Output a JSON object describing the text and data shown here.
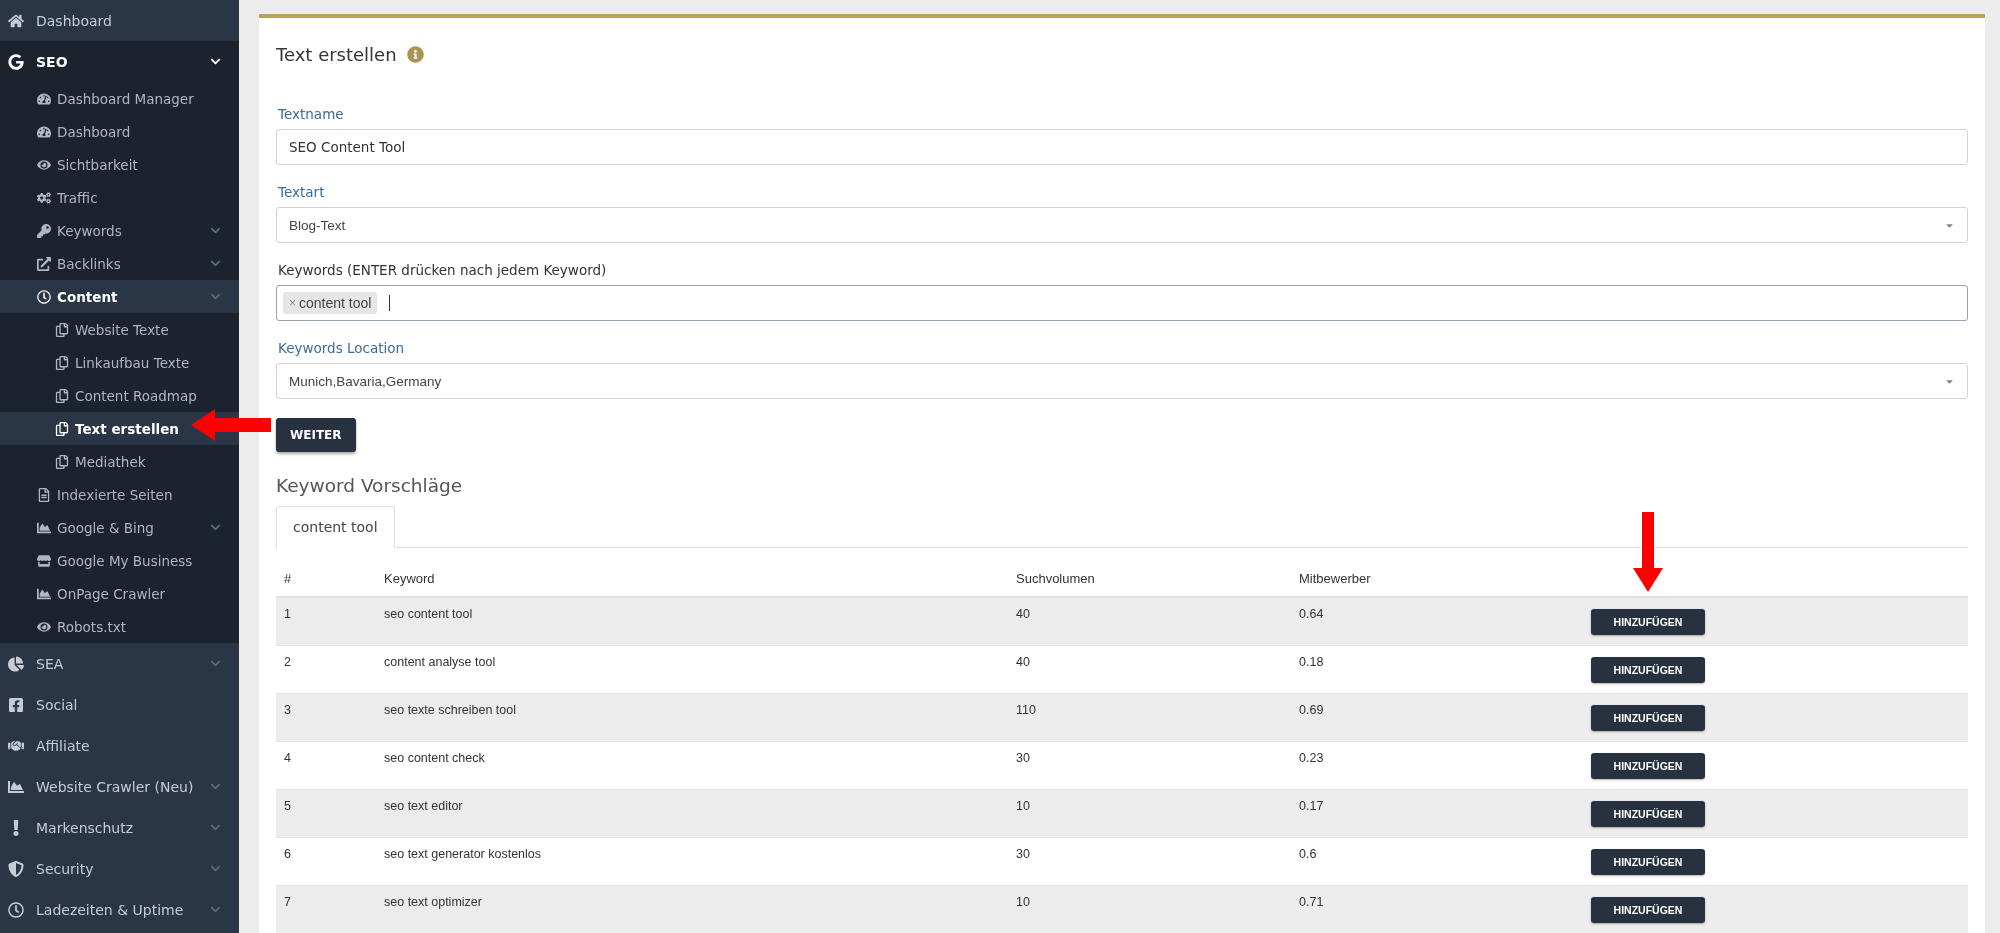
{
  "sidebar": {
    "items": [
      {
        "label": "Dashboard",
        "selected": false,
        "expandable": false
      },
      {
        "label": "SEO",
        "selected": true,
        "expandable": true,
        "expanded": true,
        "children": [
          {
            "label": "Dashboard Manager",
            "selected": false,
            "expandable": false
          },
          {
            "label": "Dashboard",
            "selected": false,
            "expandable": false
          },
          {
            "label": "Sichtbarkeit",
            "selected": false,
            "expandable": false
          },
          {
            "label": "Traffic",
            "selected": false,
            "expandable": false
          },
          {
            "label": "Keywords",
            "selected": false,
            "expandable": true
          },
          {
            "label": "Backlinks",
            "selected": false,
            "expandable": true
          },
          {
            "label": "Content",
            "selected": true,
            "expandable": true,
            "expanded": true,
            "children": [
              {
                "label": "Website Texte",
                "selected": false,
                "expandable": false
              },
              {
                "label": "Linkaufbau Texte",
                "selected": false,
                "expandable": false
              },
              {
                "label": "Content Roadmap",
                "selected": false,
                "expandable": false
              },
              {
                "label": "Text erstellen",
                "selected": true,
                "expandable": false
              },
              {
                "label": "Mediathek",
                "selected": false,
                "expandable": false
              }
            ]
          },
          {
            "label": "Indexierte Seiten",
            "selected": false,
            "expandable": false
          },
          {
            "label": "Google & Bing",
            "selected": false,
            "expandable": true
          },
          {
            "label": "Google My Business",
            "selected": false,
            "expandable": false
          },
          {
            "label": "OnPage Crawler",
            "selected": false,
            "expandable": false
          },
          {
            "label": "Robots.txt",
            "selected": false,
            "expandable": false
          }
        ]
      },
      {
        "label": "SEA",
        "selected": false,
        "expandable": true
      },
      {
        "label": "Social",
        "selected": false,
        "expandable": false
      },
      {
        "label": "Affiliate",
        "selected": false,
        "expandable": false
      },
      {
        "label": "Website Crawler (Neu)",
        "selected": false,
        "expandable": true
      },
      {
        "label": "Markenschutz",
        "selected": false,
        "expandable": true
      },
      {
        "label": "Security",
        "selected": false,
        "expandable": true
      },
      {
        "label": "Ladezeiten & Uptime",
        "selected": false,
        "expandable": true
      }
    ]
  },
  "form": {
    "title": "Text erstellen",
    "fields": [
      {
        "kind": "text",
        "label": "Textname",
        "color": "#3d6a99",
        "value": "SEO Content Tool"
      },
      {
        "kind": "select",
        "label": "Textart",
        "color": "#3d6a99",
        "value": "Blog-Text"
      },
      {
        "kind": "tags",
        "label": "Keywords (ENTER drücken nach jedem Keyword)",
        "color": "#333333",
        "tags": [
          {
            "label": "content tool",
            "remove": "×"
          }
        ]
      },
      {
        "kind": "select",
        "label": "Keywords Location",
        "color": "#3d6a99",
        "value": "Munich,Bavaria,Germany"
      }
    ],
    "submit": "WEITER"
  },
  "suggestions": {
    "title": "Keyword Vorschläge",
    "tabs": [
      {
        "label": "content tool",
        "selected": true
      }
    ],
    "table": {
      "columns": [
        "#",
        "Keyword",
        "Suchvolumen",
        "Mitbewerber"
      ],
      "rows": [
        {
          "cells": [
            "1",
            "seo content tool",
            "40",
            "0.64"
          ],
          "action": "HINZUFÜGEN"
        },
        {
          "cells": [
            "2",
            "content analyse tool",
            "40",
            "0.18"
          ],
          "action": "HINZUFÜGEN"
        },
        {
          "cells": [
            "3",
            "seo texte schreiben tool",
            "110",
            "0.69"
          ],
          "action": "HINZUFÜGEN"
        },
        {
          "cells": [
            "4",
            "seo content check",
            "30",
            "0.23"
          ],
          "action": "HINZUFÜGEN"
        },
        {
          "cells": [
            "5",
            "seo text editor",
            "10",
            "0.17"
          ],
          "action": "HINZUFÜGEN"
        },
        {
          "cells": [
            "6",
            "seo text generator kostenlos",
            "30",
            "0.6"
          ],
          "action": "HINZUFÜGEN"
        },
        {
          "cells": [
            "7",
            "seo text optimizer",
            "10",
            "0.71"
          ],
          "action": "HINZUFÜGEN"
        }
      ]
    }
  }
}
